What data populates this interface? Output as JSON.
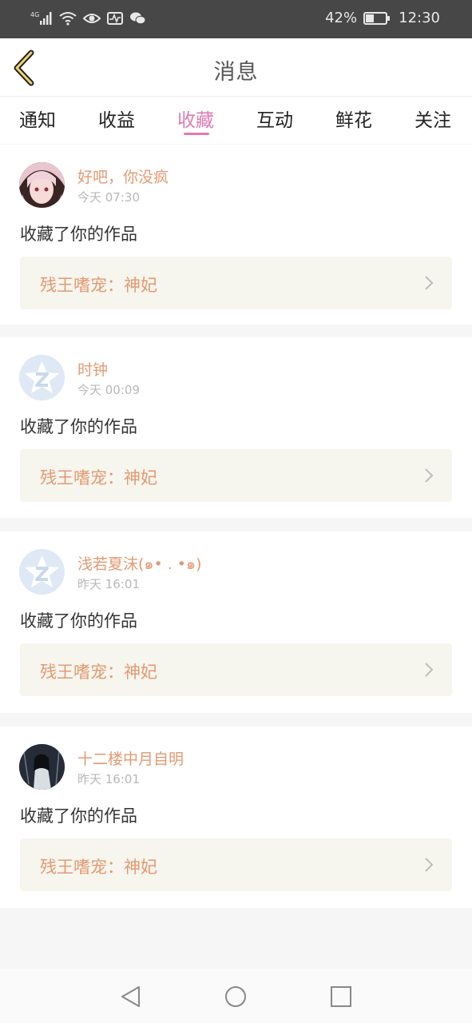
{
  "status_bar": {
    "network": "4G",
    "battery_percent_label": "42%",
    "battery_level": 0.42,
    "time": "12:30"
  },
  "header": {
    "title": "消息",
    "back_icon": "chevron-left-icon"
  },
  "tabs": [
    {
      "label": "通知",
      "active": false
    },
    {
      "label": "收益",
      "active": false
    },
    {
      "label": "收藏",
      "active": true
    },
    {
      "label": "互动",
      "active": false
    },
    {
      "label": "鲜花",
      "active": false
    },
    {
      "label": "关注",
      "active": false
    }
  ],
  "colors": {
    "accent": "#e07ab0",
    "username": "#e39a72",
    "work_box_bg": "#f6f5ee"
  },
  "notifications": [
    {
      "username": "好吧，你没疯",
      "time": "今天 07:30",
      "action": "收藏了你的作品",
      "work_title": "残王嗜宠：神妃",
      "avatar": "anime-girl-avatar"
    },
    {
      "username": "时钟",
      "time": "今天 00:09",
      "action": "收藏了你的作品",
      "work_title": "残王嗜宠：神妃",
      "avatar": "default-star-avatar"
    },
    {
      "username": "浅若夏沫(๑• . •๑)",
      "time": "昨天 16:01",
      "action": "收藏了你的作品",
      "work_title": "残王嗜宠：神妃",
      "avatar": "default-star-avatar"
    },
    {
      "username": "十二楼中月自明",
      "time": "昨天 16:01",
      "action": "收藏了你的作品",
      "work_title": "残王嗜宠：神妃",
      "avatar": "dark-portrait-avatar"
    }
  ],
  "nav_bar": {
    "back": "triangle-back-icon",
    "home": "circle-home-icon",
    "recents": "square-recents-icon"
  }
}
